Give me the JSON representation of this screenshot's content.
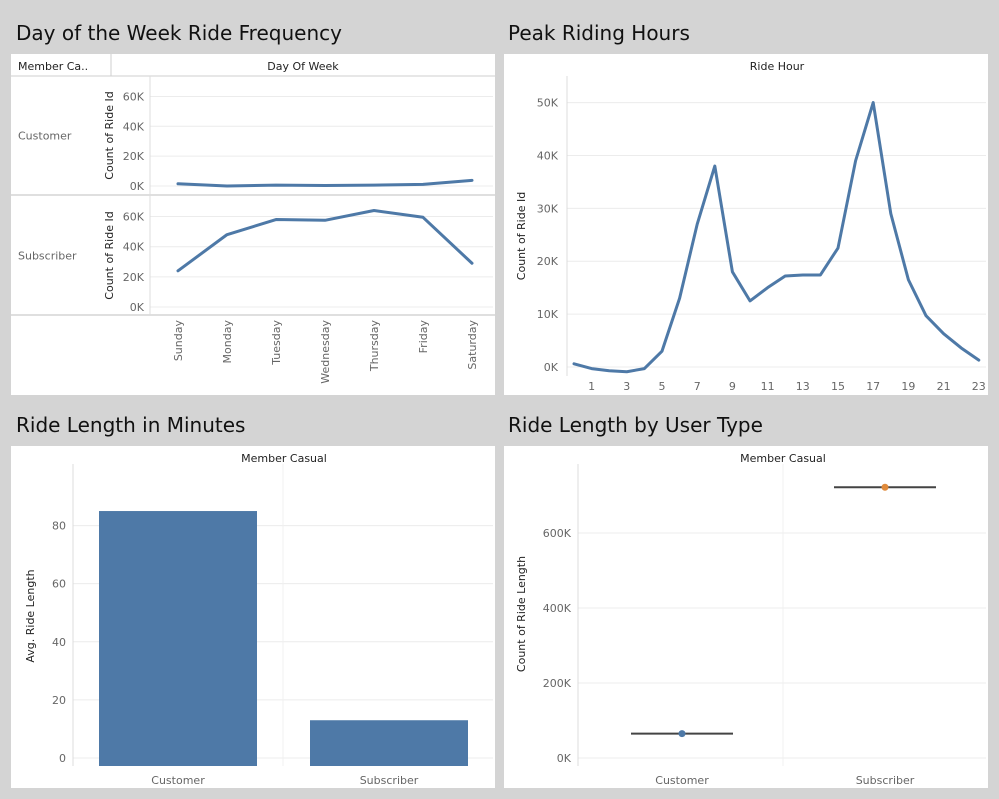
{
  "titles": {
    "dow": "Day of the Week Ride Frequency",
    "hours": "Peak Riding Hours",
    "length": "Ride Length in Minutes",
    "usertype": "Ride Length by User Type"
  },
  "colors": {
    "series": "#4e79a7",
    "subscriber_dot": "#e08a3b",
    "median_line": "#444444"
  },
  "chart_data": [
    {
      "id": "dow",
      "type": "line",
      "title": "Day of the Week Ride Frequency",
      "row_header": "Member Ca..",
      "column_header": "Day Of Week",
      "ylabel": "Count of Ride Id",
      "categories": [
        "Sunday",
        "Monday",
        "Tuesday",
        "Wednesday",
        "Thursday",
        "Friday",
        "Saturday"
      ],
      "yticks": [
        "0K",
        "20K",
        "40K",
        "60K"
      ],
      "ylim": [
        0,
        65000
      ],
      "series": [
        {
          "name": "Customer",
          "values": [
            1500,
            0,
            600,
            300,
            600,
            1100,
            3800
          ]
        },
        {
          "name": "Subscriber",
          "values": [
            24000,
            48000,
            58000,
            57500,
            64000,
            59500,
            29000
          ]
        }
      ]
    },
    {
      "id": "hours",
      "type": "line",
      "title": "Peak Riding Hours",
      "column_header": "Ride Hour",
      "ylabel": "Count of Ride Id",
      "x": [
        0,
        1,
        2,
        3,
        4,
        5,
        6,
        7,
        8,
        9,
        10,
        11,
        12,
        13,
        14,
        15,
        16,
        17,
        18,
        19,
        20,
        21,
        22,
        23
      ],
      "xticks": [
        "1",
        "3",
        "5",
        "7",
        "9",
        "11",
        "13",
        "15",
        "17",
        "19",
        "21",
        "23"
      ],
      "yticks": [
        "0K",
        "10K",
        "20K",
        "30K",
        "40K",
        "50K"
      ],
      "ylim": [
        0,
        52000
      ],
      "values": [
        600,
        -300,
        -700,
        -900,
        -300,
        3000,
        13000,
        27000,
        38000,
        18000,
        12500,
        15000,
        17200,
        17400,
        17400,
        22500,
        39000,
        50000,
        29000,
        16500,
        9700,
        6300,
        3600,
        1300
      ]
    },
    {
      "id": "length",
      "type": "bar",
      "title": "Ride Length in Minutes",
      "column_header": "Member Casual",
      "ylabel": "Avg. Ride Length",
      "categories": [
        "Customer",
        "Subscriber"
      ],
      "values": [
        85,
        13
      ],
      "yticks": [
        "0",
        "20",
        "40",
        "60",
        "80"
      ],
      "ylim": [
        0,
        90
      ]
    },
    {
      "id": "usertype",
      "type": "scatter",
      "title": "Ride Length by User Type",
      "column_header": "Member Casual",
      "ylabel": "Count of Ride Length",
      "categories": [
        "Customer",
        "Subscriber"
      ],
      "values": [
        65000,
        722000
      ],
      "yticks": [
        "0K",
        "200K",
        "400K",
        "600K"
      ],
      "ylim": [
        -10000,
        780000
      ]
    }
  ]
}
